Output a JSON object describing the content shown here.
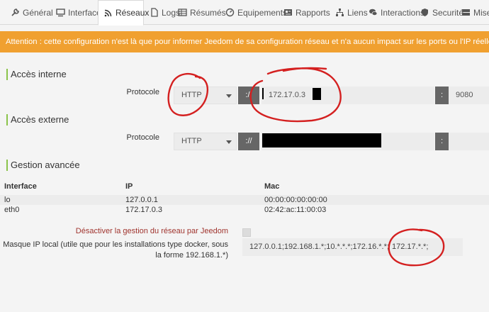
{
  "tabs": [
    {
      "label": "Général",
      "icon": "wrench-icon"
    },
    {
      "label": "Interface",
      "icon": "monitor-icon"
    },
    {
      "label": "Réseaux",
      "icon": "rss-icon"
    },
    {
      "label": "Logs",
      "icon": "file-icon"
    },
    {
      "label": "Résumés",
      "icon": "table-icon"
    },
    {
      "label": "Equipements",
      "icon": "gauge-icon"
    },
    {
      "label": "Rapports",
      "icon": "newspaper-icon"
    },
    {
      "label": "Liens",
      "icon": "sitemap-icon"
    },
    {
      "label": "Interactions",
      "icon": "comments-icon"
    },
    {
      "label": "Securité",
      "icon": "shield-icon"
    },
    {
      "label": "Mise",
      "icon": "server-icon"
    }
  ],
  "active_tab": "Réseaux",
  "banner": "Attention : cette configuration n'est là que pour informer Jeedom de sa configuration réseau et n'a aucun impact sur les ports ou l'IP réellement utilisés",
  "internal": {
    "heading": "Accès interne",
    "protocol_label": "Protocole",
    "protocol": "HTTP",
    "separator": "://",
    "address": "172.17.0.3",
    "port_separator": ":",
    "port": "9080"
  },
  "external": {
    "heading": "Accès externe",
    "protocol_label": "Protocole",
    "protocol": "HTTP",
    "separator": "://",
    "port_separator": ":"
  },
  "advanced": {
    "heading": "Gestion avancée",
    "columns": [
      "Interface",
      "IP",
      "Mac"
    ],
    "rows": [
      [
        "lo",
        "127.0.0.1",
        "00:00:00:00:00:00"
      ],
      [
        "eth0",
        "172.17.0.3",
        "02:42:ac:11:00:03"
      ]
    ],
    "disable_label": "Désactiver la gestion du réseau par Jeedom",
    "disable_checked": false,
    "mask_label_1": "Masque IP local (utile que pour les installations type docker, sous",
    "mask_label_2": "la forme 192.168.1.*)",
    "mask_value": "127.0.0.1;192.168.1.*;10.*.*.*;172.16.*.*;",
    "mask_value_2": "172.17.*.*;"
  },
  "colors": {
    "banner": "#f0a030",
    "accent": "#8bc34a",
    "annotation": "#d42020",
    "warning_text": "#a0342e"
  }
}
